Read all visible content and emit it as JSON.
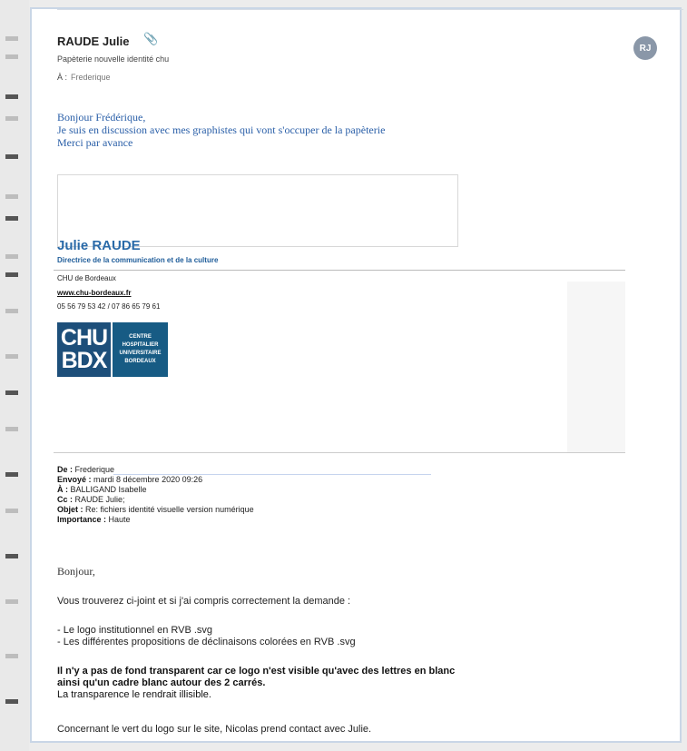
{
  "header": {
    "sender": "RAUDE Julie",
    "subject": "Papèterie nouvelle identité chu",
    "to_label": "À :",
    "to_value": "Frederique",
    "avatar_initials": "RJ"
  },
  "body": {
    "greeting_lines": [
      "Bonjour Frédérique,",
      "Je suis en discussion avec mes graphistes qui vont s'occuper de  la papèterie",
      "Merci par avance"
    ]
  },
  "signature": {
    "name": "Julie RAUDE",
    "role": "Directrice de la communication et de la culture",
    "org": "CHU de Bordeaux",
    "website": "www.chu-bordeaux.fr",
    "phone": "05 56 79 53 42 / 07 86 65 79 61",
    "logo_left": [
      "CHU",
      "BDX"
    ],
    "logo_right": [
      "CENTRE",
      "HOSPITALIER",
      "UNIVERSITAIRE",
      "BORDEAUX"
    ]
  },
  "forwarded": {
    "from_label": "De :",
    "from_value": "Frederique",
    "sent_label": "Envoyé :",
    "sent_value": "mardi 8 décembre 2020 09:26",
    "to_label": "À :",
    "to_value": "BALLIGAND Isabelle",
    "cc_label": "Cc :",
    "cc_value": "RAUDE Julie;",
    "subject_label": "Objet :",
    "subject_value": "Re: fichiers identité visuelle version numérique",
    "importance_label": "Importance :",
    "importance_value": "Haute"
  },
  "message": {
    "hello": "Bonjour,",
    "intro": "Vous trouverez ci-joint et si j'ai compris correctement la demande :",
    "bullets": [
      "- Le logo institutionnel en RVB .svg",
      "- Les différentes propositions de déclinaisons colorées en RVB .svg"
    ],
    "warning_bold_1": "Il n'y a pas de fond transparent car ce logo n'est visible qu'avec des lettres en blanc",
    "warning_bold_2": "ainsi qu'un cadre blanc autour des 2 carrés.",
    "warning_plain": "La transparence le rendrait illisible.",
    "closing": "Concernant le vert du logo sur le site, Nicolas prend contact avec Julie."
  },
  "colors": {
    "accent_blue": "#2a6aa8",
    "logo_blue": "#1d4f7a",
    "panel_border": "#c9d6e6"
  },
  "icons": {
    "attachment": "paperclip-icon"
  }
}
